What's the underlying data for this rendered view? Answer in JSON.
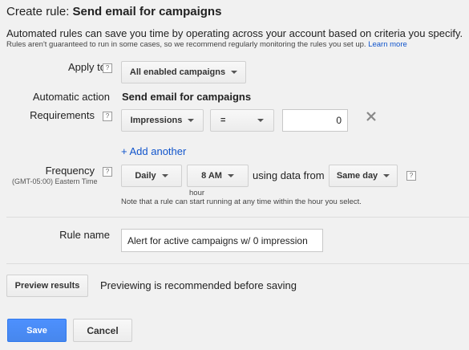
{
  "header": {
    "prefix": "Create rule:",
    "rule_type": "Send email for campaigns",
    "description": "Automated rules can save you time by operating across your account based on criteria you specify.",
    "subnote": "Rules aren't guaranteed to run in some cases, so we recommend regularly monitoring the rules you set up.",
    "learn_more": "Learn more"
  },
  "apply_to": {
    "label": "Apply to",
    "value": "All enabled campaigns"
  },
  "automatic_action": {
    "label": "Automatic action",
    "value": "Send email for campaigns"
  },
  "requirements": {
    "label": "Requirements",
    "metric": "Impressions",
    "operator": "=",
    "value": "0",
    "add_another": "+ Add another"
  },
  "frequency": {
    "label": "Frequency",
    "timezone": "(GMT-05:00) Eastern Time",
    "period": "Daily",
    "time": "8 AM",
    "time_caption": "hour",
    "using_data_from": "using data from",
    "data_range": "Same day",
    "note": "Note that a rule can start running at any time within the hour you select."
  },
  "rule_name": {
    "label": "Rule name",
    "value": "Alert for active campaigns w/ 0 impression"
  },
  "preview": {
    "button": "Preview results",
    "message": "Previewing is recommended before saving"
  },
  "footer": {
    "save": "Save",
    "cancel": "Cancel"
  },
  "help_glyph": "?",
  "icons": {
    "remove": "close-icon",
    "dropdown": "chevron-down-icon",
    "help": "help-icon"
  },
  "colors": {
    "primary": "#4a8af4",
    "link": "#1155cc",
    "background": "#f1f1f1"
  }
}
